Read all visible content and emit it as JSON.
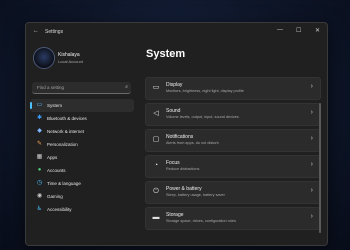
{
  "window": {
    "title": "Settings",
    "controls": {
      "minimize": "—",
      "maximize": "☐",
      "close": "✕"
    }
  },
  "profile": {
    "name": "Kishalaya",
    "account_type": "Local Account"
  },
  "search": {
    "placeholder": "Find a setting"
  },
  "sidebar": {
    "items": [
      {
        "label": "System",
        "icon": "monitor-icon",
        "color": "#4cc2ff",
        "active": true
      },
      {
        "label": "Bluetooth & devices",
        "icon": "bluetooth-icon",
        "color": "#3aa0ff"
      },
      {
        "label": "Network & internet",
        "icon": "wifi-icon",
        "color": "#7fb6ff"
      },
      {
        "label": "Personalization",
        "icon": "brush-icon",
        "color": "#f0a050"
      },
      {
        "label": "Apps",
        "icon": "apps-icon",
        "color": "#c8c8c8"
      },
      {
        "label": "Accounts",
        "icon": "person-icon",
        "color": "#4cd07a"
      },
      {
        "label": "Time & language",
        "icon": "globe-clock-icon",
        "color": "#4cc2ff"
      },
      {
        "label": "Gaming",
        "icon": "gamepad-icon",
        "color": "#c8c8c8"
      },
      {
        "label": "Accessibility",
        "icon": "accessibility-icon",
        "color": "#4cc2ff"
      }
    ]
  },
  "main": {
    "title": "System",
    "cards": [
      {
        "title": "Display",
        "description": "Monitors, brightness, night light, display profile",
        "icon": "monitor-icon"
      },
      {
        "title": "Sound",
        "description": "Volume levels, output, input, sound devices",
        "icon": "speaker-icon"
      },
      {
        "title": "Notifications",
        "description": "Alerts from apps, do not disturb",
        "icon": "bell-icon"
      },
      {
        "title": "Focus",
        "description": "Reduce distractions",
        "icon": "focus-icon"
      },
      {
        "title": "Power & battery",
        "description": "Sleep, battery usage, battery saver",
        "icon": "power-icon"
      },
      {
        "title": "Storage",
        "description": "Storage space, drives, configuration rules",
        "icon": "storage-icon"
      }
    ]
  },
  "colors": {
    "accent": "#4cc2ff",
    "window_bg": "#202020",
    "card_bg": "#2b2b2b"
  }
}
